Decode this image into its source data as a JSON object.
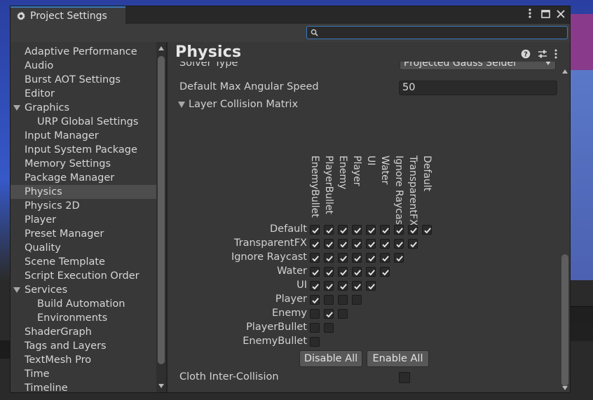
{
  "window": {
    "title": "Project Settings",
    "controls": [
      "menu",
      "maximize",
      "close"
    ]
  },
  "search": {
    "value": "",
    "placeholder": ""
  },
  "sidebar": {
    "items": [
      {
        "label": "Adaptive Performance",
        "indent": 0
      },
      {
        "label": "Audio",
        "indent": 0
      },
      {
        "label": "Burst AOT Settings",
        "indent": 0
      },
      {
        "label": "Editor",
        "indent": 0
      },
      {
        "label": "Graphics",
        "indent": 0,
        "expanded": true
      },
      {
        "label": "URP Global Settings",
        "indent": 1
      },
      {
        "label": "Input Manager",
        "indent": 0
      },
      {
        "label": "Input System Package",
        "indent": 0
      },
      {
        "label": "Memory Settings",
        "indent": 0
      },
      {
        "label": "Package Manager",
        "indent": 0
      },
      {
        "label": "Physics",
        "indent": 0,
        "selected": true
      },
      {
        "label": "Physics 2D",
        "indent": 0
      },
      {
        "label": "Player",
        "indent": 0
      },
      {
        "label": "Preset Manager",
        "indent": 0
      },
      {
        "label": "Quality",
        "indent": 0
      },
      {
        "label": "Scene Template",
        "indent": 0
      },
      {
        "label": "Script Execution Order",
        "indent": 0
      },
      {
        "label": "Services",
        "indent": 0,
        "expanded": true
      },
      {
        "label": "Build Automation",
        "indent": 1
      },
      {
        "label": "Environments",
        "indent": 1
      },
      {
        "label": "ShaderGraph",
        "indent": 0
      },
      {
        "label": "Tags and Layers",
        "indent": 0
      },
      {
        "label": "TextMesh Pro",
        "indent": 0
      },
      {
        "label": "Time",
        "indent": 0
      },
      {
        "label": "Timeline",
        "indent": 0
      }
    ]
  },
  "main": {
    "title": "Physics",
    "solver_type_label": "Solver Type",
    "solver_type_value": "Projected Gauss Seidel",
    "max_angular_speed_label": "Default Max Angular Speed",
    "max_angular_speed_value": "50",
    "collision_matrix_label": "Layer Collision Matrix",
    "cloth_label": "Cloth Inter-Collision",
    "cloth_checked": false,
    "disable_all_label": "Disable All",
    "enable_all_label": "Enable All"
  },
  "matrix": {
    "columns": [
      "EnemyBullet",
      "PlayerBullet",
      "Enemy",
      "Player",
      "UI",
      "Water",
      "Ignore Raycast",
      "TransparentFX",
      "Default"
    ],
    "rows": [
      "Default",
      "TransparentFX",
      "Ignore Raycast",
      "Water",
      "UI",
      "Player",
      "Enemy",
      "PlayerBullet",
      "EnemyBullet"
    ],
    "checked": [
      [
        true,
        true,
        true,
        true,
        true,
        true,
        true,
        true,
        true
      ],
      [
        true,
        true,
        true,
        true,
        true,
        true,
        true,
        true
      ],
      [
        true,
        true,
        true,
        true,
        true,
        true,
        true
      ],
      [
        true,
        true,
        true,
        true,
        true,
        true
      ],
      [
        true,
        true,
        true,
        true,
        true
      ],
      [
        true,
        false,
        false,
        false
      ],
      [
        false,
        true,
        false
      ],
      [
        false,
        false
      ],
      [
        false
      ]
    ]
  }
}
